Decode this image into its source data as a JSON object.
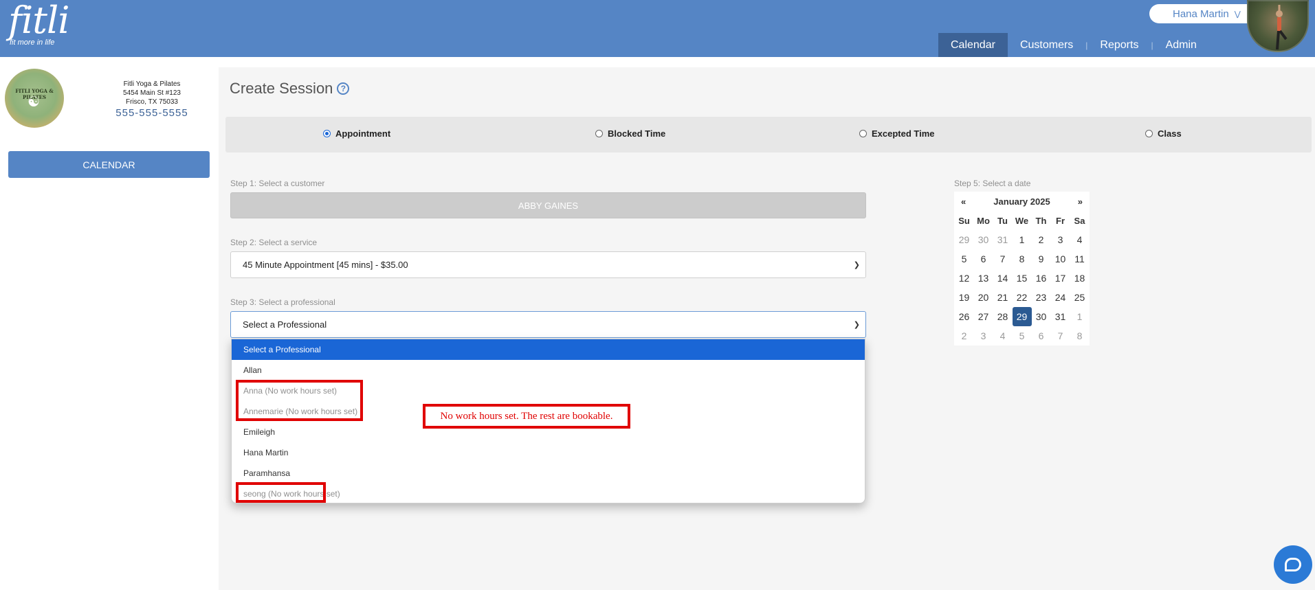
{
  "header": {
    "logo_word": "fitli",
    "logo_tagline": "fit more in life",
    "user_name": "Hana Martin",
    "nav": [
      {
        "label": "Calendar",
        "active": true
      },
      {
        "label": "Customers",
        "active": false
      },
      {
        "label": "Reports",
        "active": false
      },
      {
        "label": "Admin",
        "active": false
      }
    ]
  },
  "sidebar": {
    "studio_logo_text": "FITLI YOGA & PILATES",
    "studio_name": "Fitli Yoga & Pilates",
    "address_line1": "5454 Main St #123",
    "address_line2": "Frisco, TX 75033",
    "phone": "555-555-5555",
    "calendar_button": "CALENDAR"
  },
  "main": {
    "title": "Create Session",
    "session_types": [
      {
        "label": "Appointment",
        "checked": true
      },
      {
        "label": "Blocked Time",
        "checked": false
      },
      {
        "label": "Excepted Time",
        "checked": false
      },
      {
        "label": "Class",
        "checked": false
      }
    ],
    "step1_label": "Step 1: Select a customer",
    "customer": "ABBY GAINES",
    "step2_label": "Step 2: Select a service",
    "service_value": "45 Minute Appointment [45 mins] - $35.00",
    "step3_label": "Step 3: Select a professional",
    "professional_value": "Select a Professional",
    "professional_options": [
      {
        "label": "Select a Professional",
        "state": "selected"
      },
      {
        "label": "Allan",
        "state": "normal"
      },
      {
        "label": "Anna (No work hours set)",
        "state": "disabled"
      },
      {
        "label": "Annemarie (No work hours set)",
        "state": "disabled"
      },
      {
        "label": "Emileigh",
        "state": "normal"
      },
      {
        "label": "Hana Martin",
        "state": "normal"
      },
      {
        "label": "Paramhansa",
        "state": "normal"
      },
      {
        "label": "seong (No work hours set)",
        "state": "disabled"
      }
    ],
    "annotation_note": "No work hours set. The rest are bookable.",
    "step5_label": "Step 5: Select a date"
  },
  "calendar": {
    "prev": "«",
    "next": "»",
    "month_label": "January 2025",
    "weekdays": [
      "Su",
      "Mo",
      "Tu",
      "We",
      "Th",
      "Fr",
      "Sa"
    ],
    "days": [
      {
        "d": "29",
        "muted": true
      },
      {
        "d": "30",
        "muted": true
      },
      {
        "d": "31",
        "muted": true
      },
      {
        "d": "1"
      },
      {
        "d": "2"
      },
      {
        "d": "3"
      },
      {
        "d": "4"
      },
      {
        "d": "5"
      },
      {
        "d": "6"
      },
      {
        "d": "7"
      },
      {
        "d": "8"
      },
      {
        "d": "9"
      },
      {
        "d": "10"
      },
      {
        "d": "11"
      },
      {
        "d": "12"
      },
      {
        "d": "13"
      },
      {
        "d": "14"
      },
      {
        "d": "15"
      },
      {
        "d": "16"
      },
      {
        "d": "17"
      },
      {
        "d": "18"
      },
      {
        "d": "19"
      },
      {
        "d": "20"
      },
      {
        "d": "21"
      },
      {
        "d": "22"
      },
      {
        "d": "23"
      },
      {
        "d": "24"
      },
      {
        "d": "25"
      },
      {
        "d": "26"
      },
      {
        "d": "27"
      },
      {
        "d": "28"
      },
      {
        "d": "29",
        "today": true
      },
      {
        "d": "30"
      },
      {
        "d": "31"
      },
      {
        "d": "1",
        "muted": true
      },
      {
        "d": "2",
        "muted": true
      },
      {
        "d": "3",
        "muted": true
      },
      {
        "d": "4",
        "muted": true
      },
      {
        "d": "5",
        "muted": true
      },
      {
        "d": "6",
        "muted": true
      },
      {
        "d": "7",
        "muted": true
      },
      {
        "d": "8",
        "muted": true
      }
    ]
  },
  "colors": {
    "brand": "#5585c5",
    "nav_active": "#3c6296",
    "highlight": "#e00000",
    "selected_option": "#1a66d6"
  }
}
